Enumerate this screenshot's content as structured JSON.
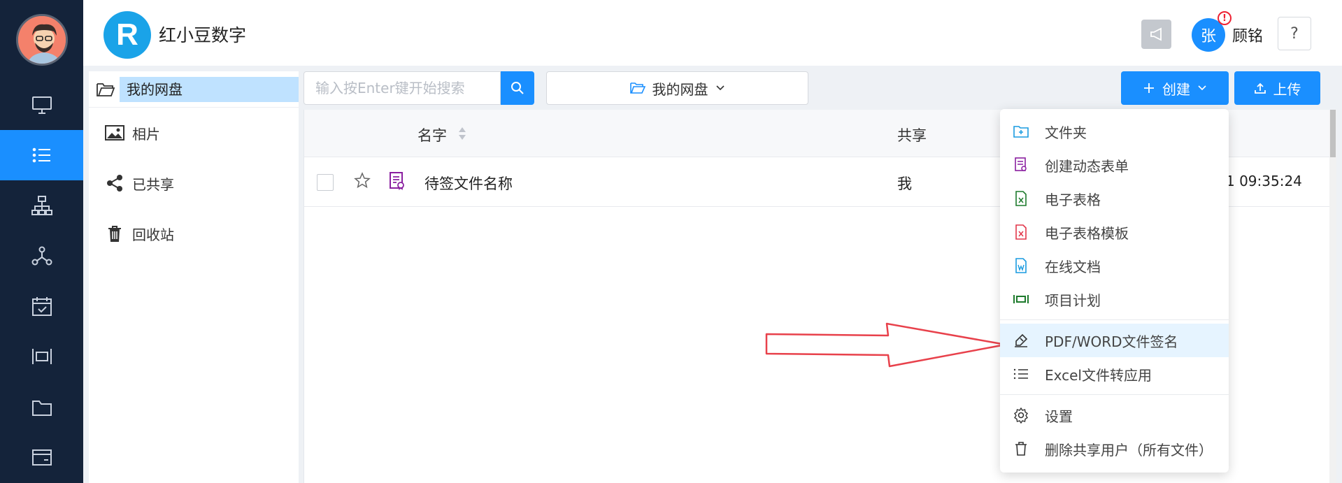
{
  "app": {
    "brand_name": "红小豆数字",
    "logo_letter": "R"
  },
  "header": {
    "user_initial": "张",
    "alert": "!",
    "user_name": "顾铭",
    "help": "?"
  },
  "nav": {
    "items": [
      {
        "name": "desktop-icon",
        "active": false
      },
      {
        "name": "list-icon",
        "active": true
      },
      {
        "name": "org-chart-icon",
        "active": false
      },
      {
        "name": "network-icon",
        "active": false
      },
      {
        "name": "calendar-check-icon",
        "active": false
      },
      {
        "name": "gantt-icon",
        "active": false
      },
      {
        "name": "folder-icon",
        "active": false
      },
      {
        "name": "wallet-icon",
        "active": false
      }
    ]
  },
  "sidebar": {
    "root_label": "我的网盘",
    "items": [
      {
        "label": "相片",
        "icon": "image-icon"
      },
      {
        "label": "已共享",
        "icon": "share-icon"
      },
      {
        "label": "回收站",
        "icon": "trash-icon"
      }
    ]
  },
  "toolbar": {
    "search_placeholder": "输入按Enter键开始搜索",
    "crumb_label": "我的网盘",
    "create_label": "创建",
    "upload_label": "上传"
  },
  "table": {
    "columns": {
      "name": "名字",
      "share": "共享"
    },
    "rows": [
      {
        "name": "待签文件名称",
        "share": "我",
        "date": "1 09:35:24"
      }
    ]
  },
  "create_menu": {
    "items": [
      {
        "label": "文件夹",
        "icon": "folder-plus-icon",
        "color": "#1a9be0"
      },
      {
        "label": "创建动态表单",
        "icon": "form-icon",
        "color": "#8a1fa0"
      },
      {
        "label": "电子表格",
        "icon": "excel-icon",
        "color": "#1d7a2c"
      },
      {
        "label": "电子表格模板",
        "icon": "excel-template-icon",
        "color": "#e2364a"
      },
      {
        "label": "在线文档",
        "icon": "word-icon",
        "color": "#1a9be0"
      },
      {
        "label": "项目计划",
        "icon": "gantt-icon",
        "color": "#1d7a2c"
      }
    ],
    "group2": [
      {
        "label": "PDF/WORD文件签名",
        "icon": "sign-pen-icon",
        "highlighted": true
      },
      {
        "label": "Excel文件转应用",
        "icon": "list-icon",
        "highlighted": false
      }
    ],
    "group3": [
      {
        "label": "设置",
        "icon": "gear-icon"
      },
      {
        "label": "删除共享用户（所有文件）",
        "icon": "trash-icon"
      }
    ]
  },
  "colors": {
    "accent": "#1a8fff",
    "nav_bg": "#14233a",
    "annotation_arrow": "#e8414b"
  }
}
